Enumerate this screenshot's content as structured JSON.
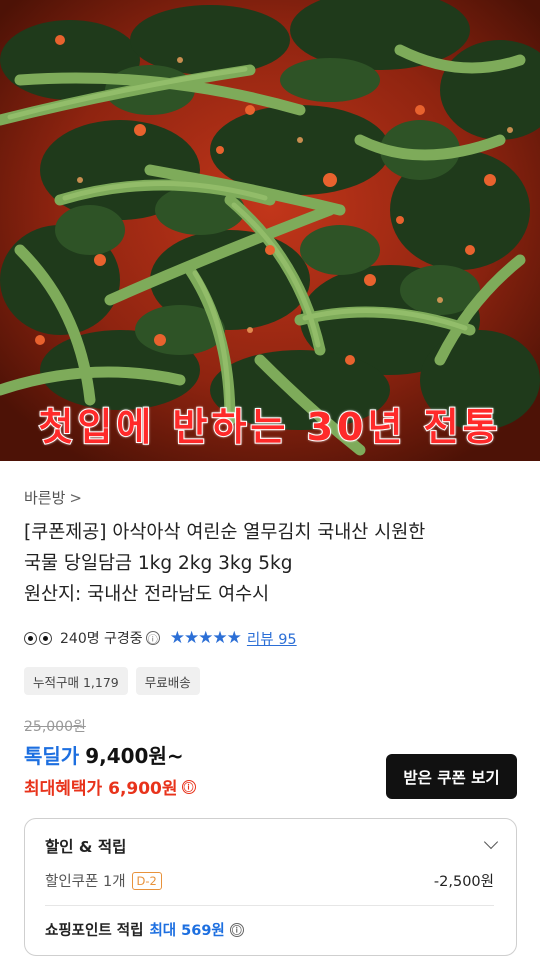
{
  "hero": {
    "caption": "첫입에 반하는 30년 전통"
  },
  "product": {
    "store_name": "바른방",
    "store_chevron": ">",
    "title_lines": [
      "[쿠폰제공] 아삭아삭 여린순 열무김치 국내산 시원한",
      "국물 당일담금 1kg 2kg 3kg 5kg",
      "원산지: 국내산 전라남도 여수시"
    ],
    "viewers": "240명 구경중",
    "info_icon": "ⓘ",
    "rating_stars": 5,
    "stars_text": "★★★★★",
    "review_label": "리뷰 95",
    "chips": [
      "누적구매 1,179",
      "무료배송"
    ]
  },
  "price": {
    "original": "25,000원",
    "deal_label": "톡딜가",
    "deal_price": "9,400원~",
    "max_benefit": "최대혜택가 6,900원",
    "coupon_button": "받은 쿠폰 보기"
  },
  "benefits": {
    "title": "할인 & 적립",
    "coupon_label": "할인쿠폰 1개",
    "coupon_badge": "D-2",
    "coupon_amount": "-2,500원",
    "points_label": "쇼핑포인트 적립",
    "points_value": "최대 569원"
  },
  "colors": {
    "accent_blue": "#1d6fe0",
    "accent_red": "#e8331b",
    "badge_orange": "#e8923b",
    "button_dark": "#111111"
  }
}
